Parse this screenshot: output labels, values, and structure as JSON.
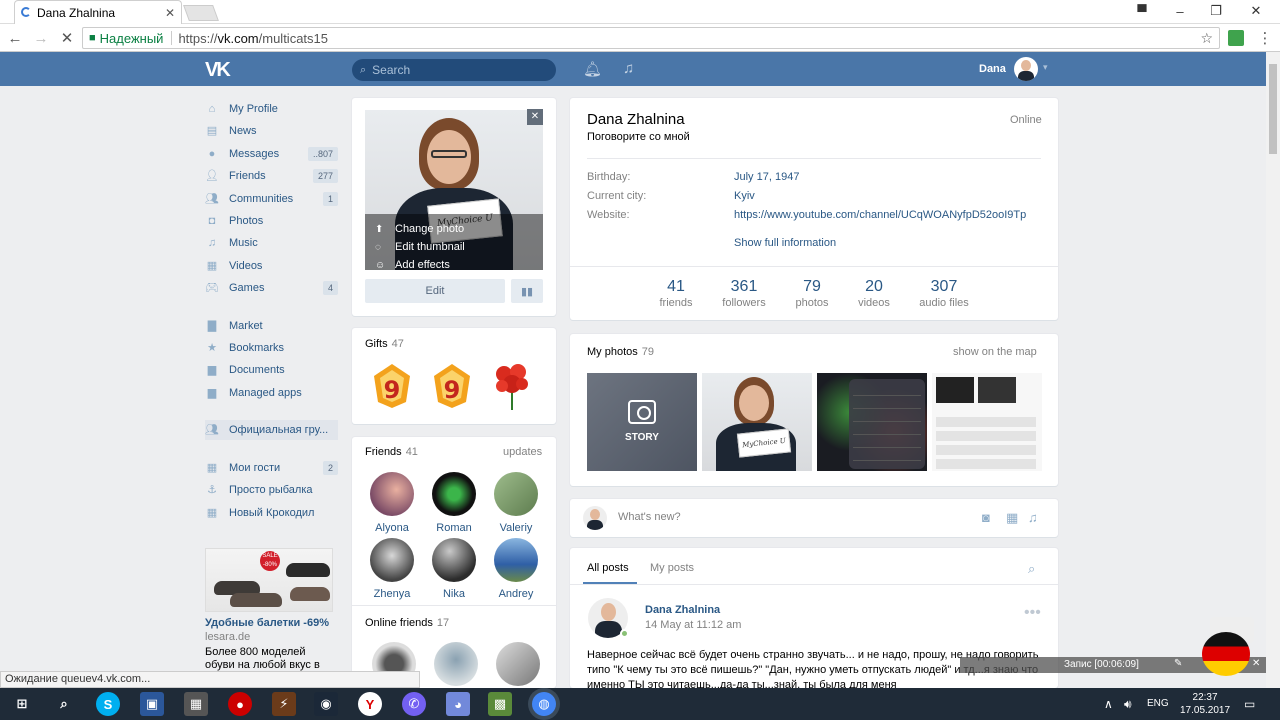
{
  "browser": {
    "tab_title": "Dana Zhalnina",
    "secure_label": "Надежный",
    "url_scheme": "https://",
    "url_host": "vk.com",
    "url_path": "/multicats15",
    "status_text": "Ожидание queuev4.vk.com..."
  },
  "header": {
    "search_placeholder": "Search",
    "user_name": "Dana"
  },
  "menu": [
    {
      "label": "My Profile",
      "icon": "home-icon",
      "count": ""
    },
    {
      "label": "News",
      "icon": "news-icon",
      "count": ""
    },
    {
      "label": "Messages",
      "icon": "messages-icon",
      "count": "..807"
    },
    {
      "label": "Friends",
      "icon": "friends-icon",
      "count": "277"
    },
    {
      "label": "Communities",
      "icon": "communities-icon",
      "count": "1"
    },
    {
      "label": "Photos",
      "icon": "camera-icon",
      "count": ""
    },
    {
      "label": "Music",
      "icon": "music-icon",
      "count": ""
    },
    {
      "label": "Videos",
      "icon": "video-icon",
      "count": ""
    },
    {
      "label": "Games",
      "icon": "gamepad-icon",
      "count": "4"
    },
    {
      "label": "Market",
      "icon": "market-icon",
      "count": ""
    },
    {
      "label": "Bookmarks",
      "icon": "star-icon",
      "count": ""
    },
    {
      "label": "Documents",
      "icon": "document-icon",
      "count": ""
    },
    {
      "label": "Managed apps",
      "icon": "apps-icon",
      "count": ""
    },
    {
      "label": "Официальная гру...",
      "icon": "group-icon",
      "count": ""
    },
    {
      "label": "Мои гости",
      "icon": "app-grid-icon",
      "count": "2"
    },
    {
      "label": "Просто рыбалка",
      "icon": "anchor-icon",
      "count": ""
    },
    {
      "label": "Новый Крокодил",
      "icon": "app-grid-icon",
      "count": ""
    }
  ],
  "ad": {
    "sale_badge": "SALE -80%",
    "title": "Удобные балетки -69%",
    "domain": "lesara.de",
    "description": "Более 800 моделей обуви на любой вкус в"
  },
  "photo_menu": {
    "change": "Change photo",
    "thumbnail": "Edit thumbnail",
    "effects": "Add effects",
    "sign_text": "MyChoice U"
  },
  "edit_label": "Edit",
  "gifts": {
    "title": "Gifts",
    "count": "47"
  },
  "friends": {
    "title": "Friends",
    "count": "41",
    "updates": "updates",
    "items": [
      "Alyona",
      "Roman",
      "Valeriy",
      "Zhenya",
      "Nika",
      "Andrey"
    ],
    "online_title": "Online friends",
    "online_count": "17"
  },
  "profile": {
    "name": "Dana Zhalnina",
    "status": "Поговорите со мной",
    "online": "Online",
    "fields": [
      {
        "label": "Birthday:",
        "value": "July 17, 1947"
      },
      {
        "label": "Current city:",
        "value": "Kyiv"
      },
      {
        "label": "Website:",
        "value": "https://www.youtube.com/channel/UCqWOANyfpD52ooI9Tp"
      }
    ],
    "show_full": "Show full information",
    "stats": [
      {
        "num": "41",
        "label": "friends"
      },
      {
        "num": "361",
        "label": "followers"
      },
      {
        "num": "79",
        "label": "photos"
      },
      {
        "num": "20",
        "label": "videos"
      },
      {
        "num": "307",
        "label": "audio files"
      }
    ]
  },
  "photos": {
    "title": "My photos",
    "count": "79",
    "map_link": "show on the map",
    "story_label": "STORY"
  },
  "whats_new_placeholder": "What's new?",
  "posts": {
    "tab_all": "All posts",
    "tab_my": "My posts",
    "author": "Dana Zhalnina",
    "date": "14 May at 11:12 am",
    "text": "Наверное сейчас всё будет очень странно звучать... и не надо, прошу, не надо говорить типо \"К чему ты это всё пишешь?\" \"Дан, нужно уметь отпускать людей\" и тд...я знаю что именно ТЫ это читаешь...да-да ты...знай, ты была для меня"
  },
  "recorder": {
    "label": "Запис [00:06:09]"
  },
  "taskbar": {
    "lang": "ENG",
    "time": "22:37",
    "date": "17.05.2017"
  }
}
